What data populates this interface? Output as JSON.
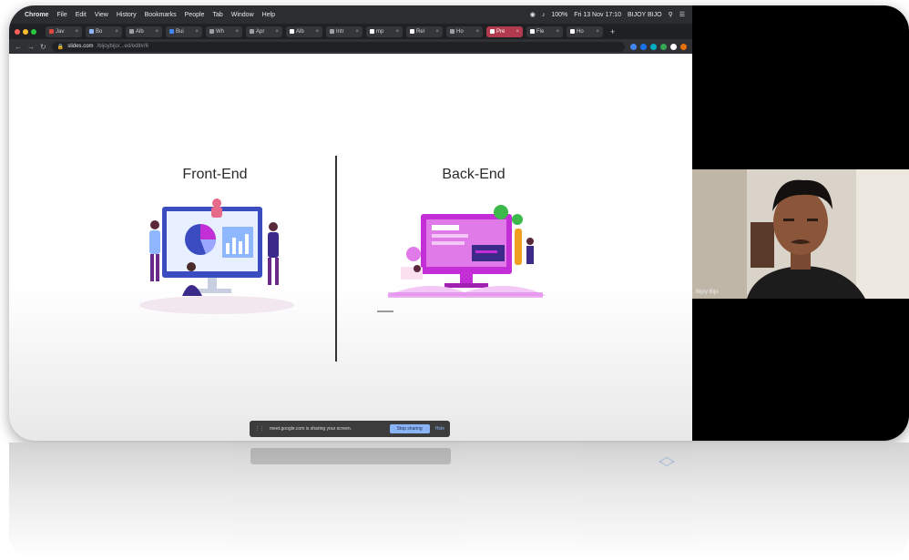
{
  "menubar": {
    "app_name": "Chrome",
    "items": [
      "File",
      "Edit",
      "View",
      "History",
      "Bookmarks",
      "People",
      "Tab",
      "Window",
      "Help"
    ],
    "battery": "100%",
    "datetime": "Fri 13 Nov 17:10",
    "user": "BIJOY BIJO"
  },
  "tabs": [
    {
      "label": "Jav",
      "color": "#e0443e"
    },
    {
      "label": "Bo",
      "color": "#8fb7ff"
    },
    {
      "label": "Alb",
      "color": "#9aa0a6"
    },
    {
      "label": "Bui",
      "color": "#4285f4"
    },
    {
      "label": "Wh",
      "color": "#9aa0a6"
    },
    {
      "label": "Apr",
      "color": "#9aa0a6"
    },
    {
      "label": "Alb",
      "color": "#ffffff"
    },
    {
      "label": "Intr",
      "color": "#9aa0a6"
    },
    {
      "label": "mp",
      "color": "#ffffff"
    },
    {
      "label": "Rel",
      "color": "#ffffff"
    },
    {
      "label": "Ho",
      "color": "#9aa0a6"
    },
    {
      "label": "Pre",
      "color": "#ffffff",
      "active": true
    },
    {
      "label": "Fle",
      "color": "#ffffff"
    },
    {
      "label": "Ho",
      "color": "#ffffff"
    }
  ],
  "address": {
    "domain": "slides.com",
    "path": "/bijoybijo/...ed/edit#/6"
  },
  "slide": {
    "left_heading": "Front-End",
    "right_heading": "Back-End"
  },
  "share_bar": {
    "message": "meet.google.com is sharing your screen.",
    "stop_label": "Stop sharing",
    "hide_label": "Hide"
  },
  "video": {
    "participant": "Bijoy Bijo"
  },
  "colors": {
    "accent": "#1a73e8",
    "active_tab": "#b23a4e",
    "illus_purple": "#c32ed6",
    "illus_blue": "#3b4cc0"
  }
}
